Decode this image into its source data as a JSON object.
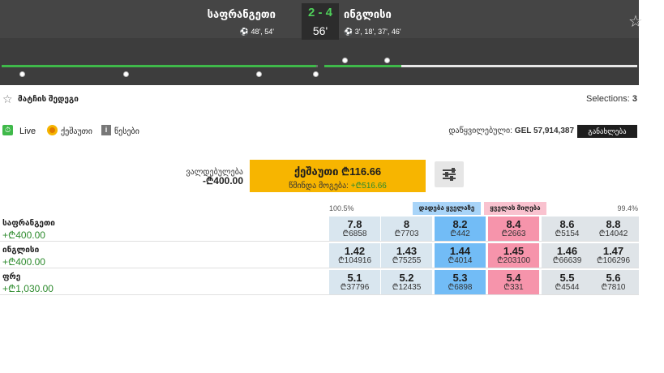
{
  "scoreboard": {
    "home_team": "საფრანგეთი",
    "away_team": "ინგლისი",
    "score": "2 - 4",
    "minute": "56'",
    "home_goals": "⚽ 48', 54'",
    "away_goals": "⚽ 3', 18', 37', 46'"
  },
  "market": {
    "title": "მატჩის შედეგი",
    "selections_label": "Selections:",
    "selections_count": "3"
  },
  "status": {
    "live_label": "Live",
    "cashout_label": "ქეშაუთი",
    "rules_label": "წესები",
    "matched_label": "დაწყვილებული:",
    "matched_amount": "GEL 57,914,387",
    "refresh_label": "განახლება"
  },
  "cashout": {
    "liability_label": "ვალდებულება",
    "liability_value": "-₾400.00",
    "button_label": "ქეშაუთი ₾116.66",
    "profit_label": "წმინდა მოგება:",
    "profit_value": "+₾516.66"
  },
  "grid": {
    "back_pct": "100.5%",
    "lay_pct": "99.4%",
    "back_all_label": "დადება ყველაზე",
    "lay_all_label": "ყველას მიღება",
    "runners": [
      {
        "name": "საფრანგეთი",
        "pl": "+₾400.00",
        "cells": [
          {
            "price": "7.8",
            "size": "₾6858"
          },
          {
            "price": "8",
            "size": "₾7703"
          },
          {
            "price": "8.2",
            "size": "₾442"
          },
          {
            "price": "8.4",
            "size": "₾2663"
          },
          {
            "price": "8.6",
            "size": "₾5154"
          },
          {
            "price": "8.8",
            "size": "₾14042"
          }
        ]
      },
      {
        "name": "ინგლისი",
        "pl": "+₾400.00",
        "cells": [
          {
            "price": "1.42",
            "size": "₾104916"
          },
          {
            "price": "1.43",
            "size": "₾75255"
          },
          {
            "price": "1.44",
            "size": "₾4014"
          },
          {
            "price": "1.45",
            "size": "₾203100"
          },
          {
            "price": "1.46",
            "size": "₾66639"
          },
          {
            "price": "1.47",
            "size": "₾106296"
          }
        ]
      },
      {
        "name": "ფრე",
        "pl": "+₾1,030.00",
        "cells": [
          {
            "price": "5.1",
            "size": "₾37796"
          },
          {
            "price": "5.2",
            "size": "₾12435"
          },
          {
            "price": "5.3",
            "size": "₾6898"
          },
          {
            "price": "5.4",
            "size": "₾331"
          },
          {
            "price": "5.5",
            "size": "₾4544"
          },
          {
            "price": "5.6",
            "size": "₾7810"
          }
        ]
      }
    ]
  },
  "colors": {
    "back_best": "#72bcf6",
    "lay_best": "#f694ab",
    "cashout": "#f7b500",
    "score_green": "#4fcf5a"
  }
}
